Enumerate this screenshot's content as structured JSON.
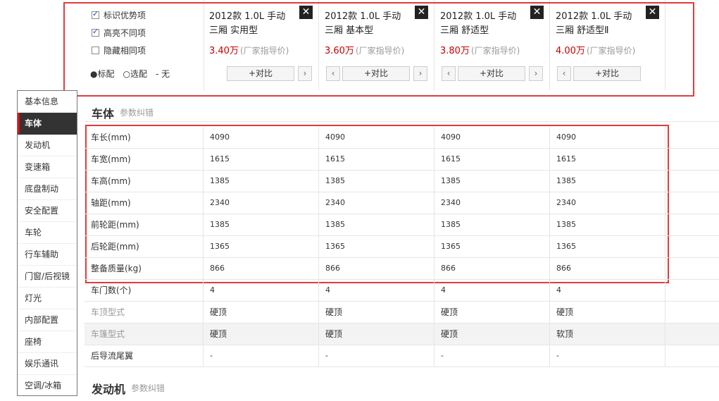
{
  "options": {
    "mark_advantage": "标识优势项",
    "highlight_diff": "高亮不同项",
    "hide_same": "隐藏相同项",
    "legend_standard": "●标配",
    "legend_optional": "○选配",
    "legend_none": "- 无"
  },
  "cars": [
    {
      "name_line1": "2012款 1.0L 手动",
      "name_line2": "三厢 实用型",
      "price": "3.40万",
      "price_note": "(厂家指导价)",
      "close": "✕",
      "compare": "+对比",
      "prev": "‹",
      "next": "›"
    },
    {
      "name_line1": "2012款 1.0L 手动",
      "name_line2": "三厢 基本型",
      "price": "3.60万",
      "price_note": "(厂家指导价)",
      "close": "✕",
      "compare": "+对比",
      "prev": "‹",
      "next": "›"
    },
    {
      "name_line1": "2012款 1.0L 手动",
      "name_line2": "三厢 舒适型",
      "price": "3.80万",
      "price_note": "(厂家指导价)",
      "close": "✕",
      "compare": "+对比",
      "prev": "‹",
      "next": "›"
    },
    {
      "name_line1": "2012款 1.0L 手动",
      "name_line2": "三厢 舒适型Ⅱ",
      "price": "4.00万",
      "price_note": "(厂家指导价)",
      "close": "✕",
      "compare": "+对比",
      "prev": "‹",
      "next": "›"
    }
  ],
  "nav": [
    "基本信息",
    "车体",
    "发动机",
    "变速箱",
    "底盘制动",
    "安全配置",
    "车轮",
    "行车辅助",
    "门窗/后视镜",
    "灯光",
    "内部配置",
    "座椅",
    "娱乐通讯",
    "空调/冰箱"
  ],
  "nav_active_index": 1,
  "section_body": {
    "title": "车体",
    "link": "参数纠错"
  },
  "section_engine": {
    "title": "发动机",
    "link": "参数纠错"
  },
  "rows": [
    {
      "label": "车长(mm)",
      "values": [
        "4090",
        "4090",
        "4090",
        "4090"
      ]
    },
    {
      "label": "车宽(mm)",
      "values": [
        "1615",
        "1615",
        "1615",
        "1615"
      ]
    },
    {
      "label": "车高(mm)",
      "values": [
        "1385",
        "1385",
        "1385",
        "1385"
      ]
    },
    {
      "label": "轴距(mm)",
      "values": [
        "2340",
        "2340",
        "2340",
        "2340"
      ]
    },
    {
      "label": "前轮距(mm)",
      "values": [
        "1385",
        "1385",
        "1385",
        "1385"
      ]
    },
    {
      "label": "后轮距(mm)",
      "values": [
        "1365",
        "1365",
        "1365",
        "1365"
      ]
    },
    {
      "label": "整备质量(kg)",
      "values": [
        "866",
        "866",
        "866",
        "866"
      ]
    },
    {
      "label": "车门数(个)",
      "values": [
        "4",
        "4",
        "4",
        "4"
      ]
    },
    {
      "label": "车顶型式",
      "values": [
        "硬顶",
        "硬顶",
        "硬顶",
        "硬顶"
      ],
      "muted": true
    },
    {
      "label": "车篷型式",
      "values": [
        "硬顶",
        "硬顶",
        "硬顶",
        "软顶"
      ],
      "muted": true,
      "shaded": true
    },
    {
      "label": "后导流尾翼",
      "values": [
        "-",
        "-",
        "-",
        "-"
      ]
    }
  ],
  "colors": {
    "price": "#c40000",
    "highlight_border": "#e03c3c",
    "nav_active_bg": "#333333",
    "nav_active_bar": "#dd1111"
  }
}
